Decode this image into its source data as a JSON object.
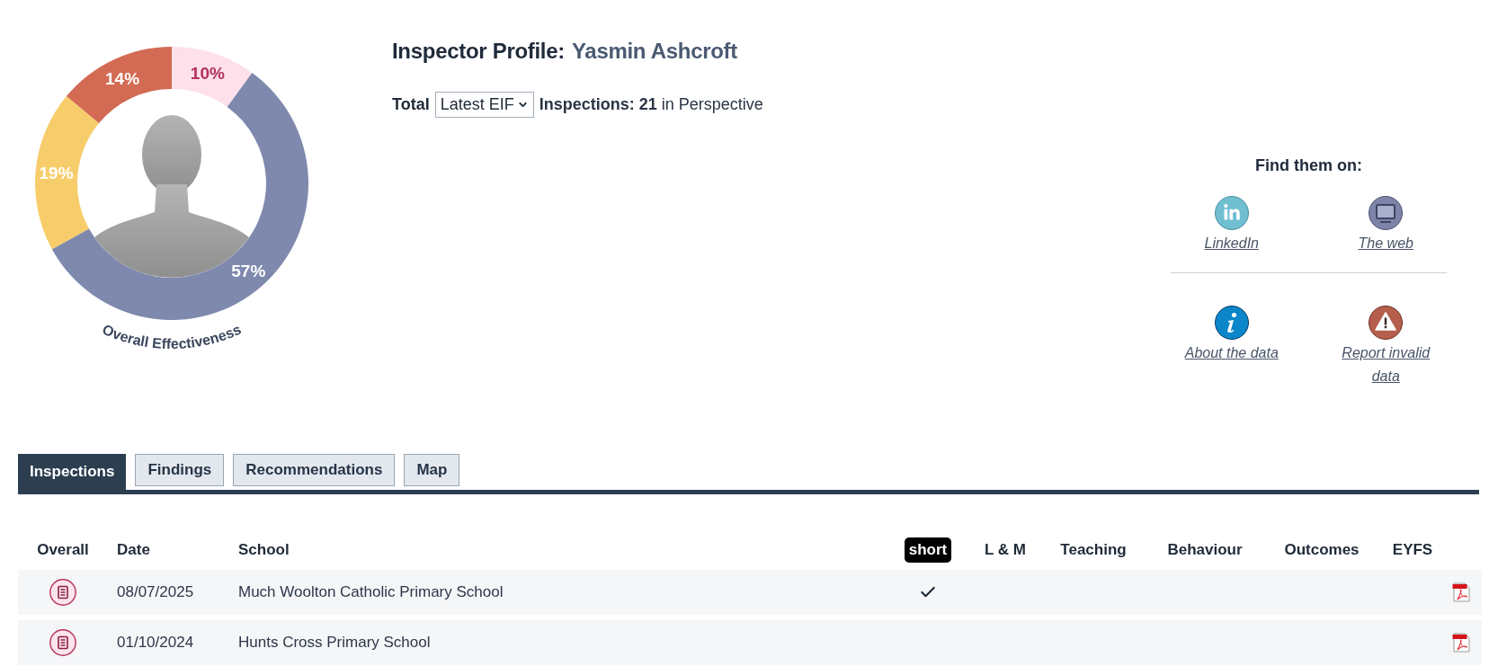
{
  "chart": {
    "chart_data": {
      "type": "donut",
      "title": "Overall Effectiveness",
      "values": [
        10,
        57,
        19,
        14
      ],
      "value_labels": [
        "10%",
        "57%",
        "19%",
        "14%"
      ]
    }
  },
  "profile": {
    "heading": "Inspector Profile:",
    "name": "Yasmin Ashcroft"
  },
  "filter": {
    "label": "Total",
    "select_value": "Latest EIF",
    "summary": "**Inspections: 21** in Perspective"
  },
  "links": {
    "title": "Find them on:",
    "profiles": [
      {
        "kind": "linkedin",
        "label": "LinkedIn"
      },
      {
        "kind": "web",
        "label": "The web"
      }
    ],
    "resources": [
      {
        "kind": "about",
        "label": "About the data"
      },
      {
        "kind": "report",
        "label": "Report invalid data"
      }
    ]
  },
  "tabs": [
    {
      "label": "Inspections",
      "selected": true
    },
    {
      "label": "Findings",
      "selected": false
    },
    {
      "label": "Recommendations",
      "selected": false
    },
    {
      "label": "Map",
      "selected": false
    }
  ],
  "table": {
    "columns": [
      {
        "label": "Overall",
        "kind": "text"
      },
      {
        "label": "Date",
        "kind": "text"
      },
      {
        "label": "School",
        "kind": "text"
      },
      {
        "label": "short",
        "kind": "badge"
      },
      {
        "label": "L & M",
        "kind": "text"
      },
      {
        "label": "Teaching",
        "kind": "text"
      },
      {
        "label": "Behaviour",
        "kind": "text"
      },
      {
        "label": "Outcomes",
        "kind": "text"
      },
      {
        "label": "EYFS",
        "kind": "text"
      }
    ],
    "rows": [
      {
        "color": "#fce4ec",
        "date": "08/07/2025",
        "school": "Much Woolton Catholic Primary School",
        "short": true
      },
      {
        "color": "#fce4ec",
        "date": "01/10/2024",
        "school": "Hunts Cross Primary School",
        "short": false
      }
    ]
  }
}
